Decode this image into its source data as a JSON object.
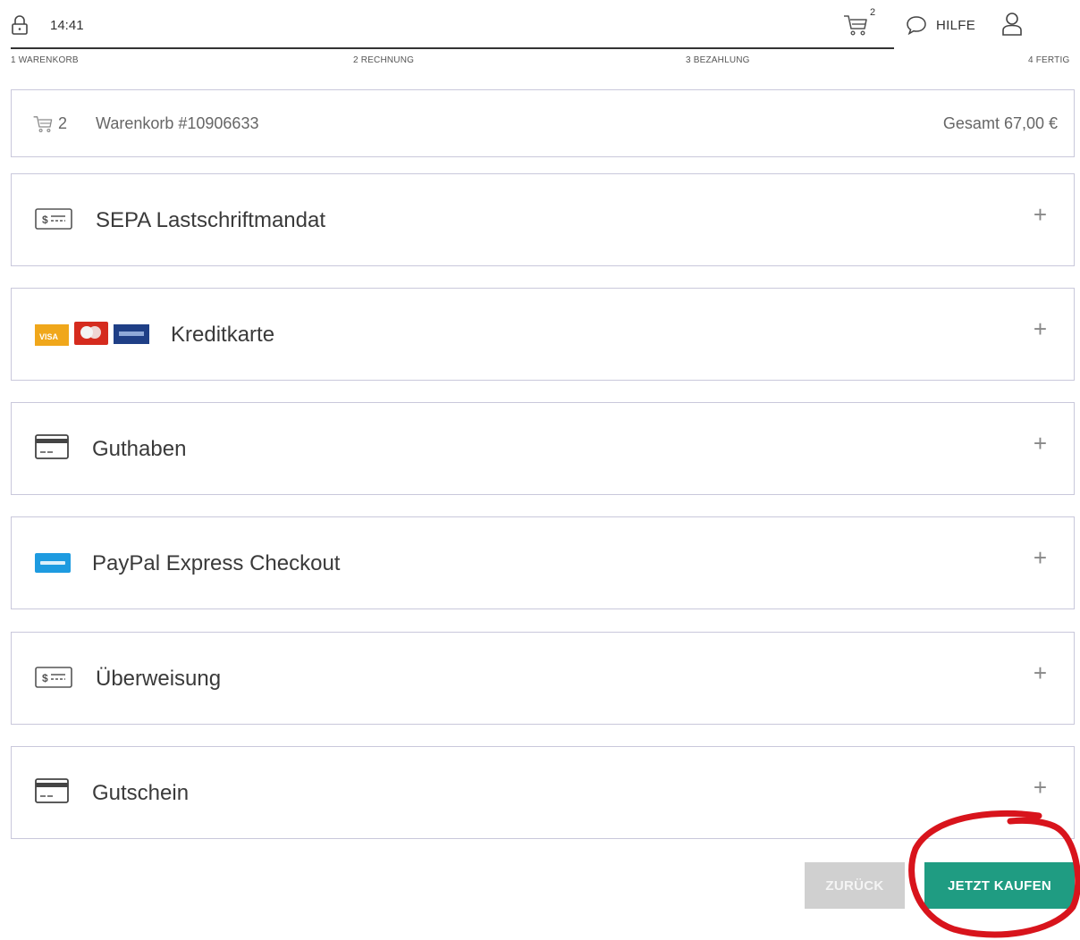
{
  "header": {
    "time": "14:41",
    "cart_count": "2",
    "help_label": "HILFE"
  },
  "steps": [
    {
      "label": "1 WARENKORB",
      "state": "done"
    },
    {
      "label": "2 RECHNUNG",
      "state": "done"
    },
    {
      "label": "3 BEZAHLUNG",
      "state": "current"
    },
    {
      "label": "4 FERTIG",
      "state": "pending"
    }
  ],
  "summary": {
    "cart_qty": "2",
    "cart_title": "Warenkorb #10906633",
    "total": "Gesamt 67,00 €"
  },
  "payment_methods": [
    {
      "label": "SEPA Lastschriftmandat",
      "icon": "sepa-icon"
    },
    {
      "label": "Kreditkarte",
      "icon": "credit-card-logos-icon"
    },
    {
      "label": "Guthaben",
      "icon": "card-icon"
    },
    {
      "label": "PayPal Express Checkout",
      "icon": "paypal-icon"
    },
    {
      "label": "Überweisung",
      "icon": "transfer-icon"
    },
    {
      "label": "Gutschein",
      "icon": "voucher-card-icon"
    }
  ],
  "expand_symbol": "+",
  "buttons": {
    "back_label": "ZURÜCK",
    "buy_label": "JETZT KAUFEN"
  },
  "colors": {
    "primary_button": "#1f9c82",
    "disabled_button": "#d0d0d0",
    "highlight_circle": "#d8141c",
    "panel_border": "#c9c8db"
  }
}
